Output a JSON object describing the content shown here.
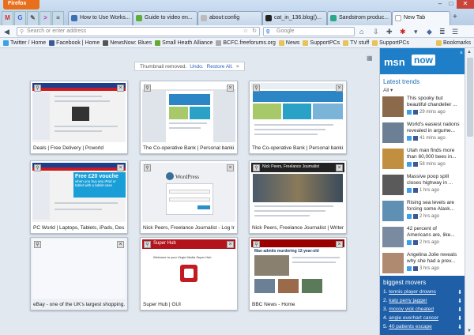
{
  "browser": {
    "firefox_button": "Firefox",
    "app_tabs": [
      "M",
      "G",
      "✎",
      ">"
    ],
    "tabs": [
      {
        "label": "How to Use Works...",
        "color": "#3b6fb6"
      },
      {
        "label": "Guide to video en...",
        "color": "#5ab03a"
      },
      {
        "label": "about:config",
        "color": "#999999"
      },
      {
        "label": "cat_in_136.blog()...",
        "color": "#222222"
      },
      {
        "label": "Sandstrom produc...",
        "color": "#2aa88a"
      },
      {
        "label": "New Tab",
        "color": "#ffffff"
      }
    ],
    "new_tab_glyph": "+",
    "url_placeholder": "Search or enter address",
    "search_placeholder": "Google",
    "bookmarks": [
      {
        "label": "Twitter / Home",
        "color": "#3ba0e6"
      },
      {
        "label": "Facebook | Home",
        "color": "#3b5998"
      },
      {
        "label": "NewsNow: Blues",
        "color": "#333333"
      },
      {
        "label": "Small Heath Alliance",
        "color": "#6a3"
      },
      {
        "label": "BCFC.freeforums.org",
        "color": "#999"
      },
      {
        "label": "News",
        "color": "#e8c25a"
      },
      {
        "label": "SupportPCs",
        "color": "#e8c25a"
      },
      {
        "label": "TV stuff",
        "color": "#e8c25a"
      },
      {
        "label": "SupportPCs",
        "color": "#e8c25a"
      }
    ],
    "bookmarks_menu": "Bookmarks"
  },
  "notice": {
    "text": "Thumbnail removed.",
    "undo": "Undo.",
    "restore": "Restore All.",
    "close": "×"
  },
  "thumbnails": [
    {
      "caption": "Deals | Free Delivery | Pcworld",
      "style": "pcworld"
    },
    {
      "caption": "The Co-operative Bank | Personal banki...",
      "style": "coop"
    },
    {
      "caption": "The Co-operative Bank | Personal banki...",
      "style": "coop"
    },
    {
      "caption": "PC World | Laptops, Tablets, iPads, Des...",
      "style": "pcworld2"
    },
    {
      "caption": "Nick Peers, Freelance Journalist - Log In",
      "style": "wp"
    },
    {
      "caption": "Nick Peers, Freelance Journalist | Writer...",
      "style": "nick"
    },
    {
      "caption": "eBay - one of the UK's largest shopping...",
      "style": "blank"
    },
    {
      "caption": "Super Hub | GUI",
      "style": "superhub"
    },
    {
      "caption": "BBC News - Home",
      "style": "bbc"
    }
  ],
  "thumb_texts": {
    "pcworld_banner": "Free £20 vouche",
    "pcworld_sub": "when you buy any iPad or tablet with a tablet case",
    "wordpress": "WordPress",
    "nick_header": "Nick Peers, Freelance Journalist",
    "superhub_title": "Super Hub",
    "superhub_msg": "Welcome to your Virgin Media Super Hub",
    "bbc_head": "Man admits murdering 12-year-old"
  },
  "sidebar": {
    "logo": "msn",
    "now": "now",
    "close": "×",
    "trends_title": "Latest trends",
    "all_label": "All ▾",
    "trends": [
      {
        "text": "This spooky but beautiful chandelier ...",
        "age": "29 mins ago",
        "color": "#8a6a4a"
      },
      {
        "text": "World's easiest nations revealed in argume...",
        "age": "41 mins ago",
        "color": "#6b7f95"
      },
      {
        "text": "Utah man finds more than 60,000 bees in...",
        "age": "58 mins ago",
        "color": "#c09040"
      },
      {
        "text": "Massive poop spill closes highway in ...",
        "age": "1 hrs ago",
        "color": "#5a5a5a"
      },
      {
        "text": "Rising sea levels are forcing some Alask...",
        "age": "2 hrs ago",
        "color": "#5f8fb2"
      },
      {
        "text": "42 percent of Americans are, like...",
        "age": "2 hrs ago",
        "color": "#7a8aa0"
      },
      {
        "text": "Angelina Jolie reveals why she had a prev...",
        "age": "3 hrs ago",
        "color": "#b08a70"
      }
    ],
    "movers_title": "biggest movers",
    "movers": [
      {
        "rank": "1.",
        "text": "tennis player drowns"
      },
      {
        "rank": "2.",
        "text": "katy perry jagger"
      },
      {
        "rank": "3.",
        "text": "mccov vick cheated"
      },
      {
        "rank": "4.",
        "text": "angie everhart cancer"
      },
      {
        "rank": "5.",
        "text": "40 patients escape"
      }
    ]
  }
}
